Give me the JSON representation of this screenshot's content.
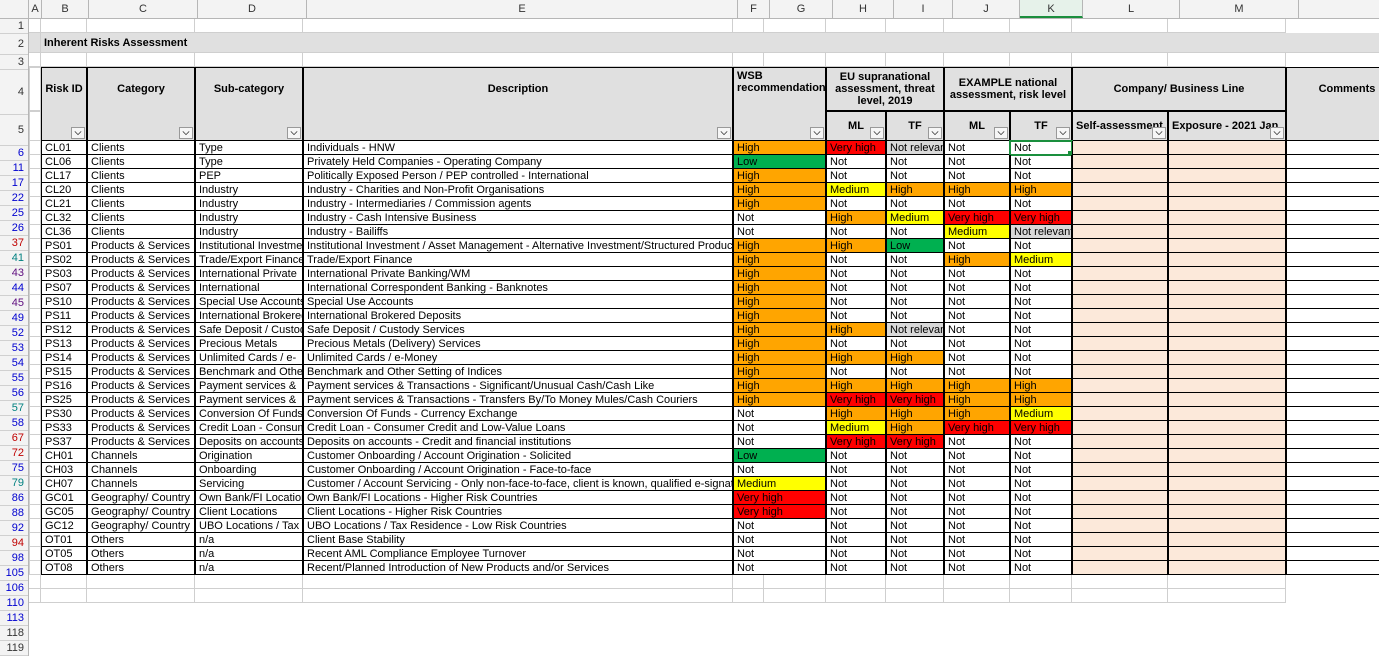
{
  "cols": [
    "A",
    "B",
    "C",
    "D",
    "E",
    "F",
    "G",
    "H",
    "I",
    "J",
    "K",
    "L",
    "M"
  ],
  "title": "Inherent Risks Assessment",
  "headers": {
    "riskId": "Risk ID",
    "category": "Category",
    "subcat": "Sub-category",
    "desc": "Description",
    "wsb": "WSB recommendation",
    "eu": "EU supranational assessment, threat level, 2019",
    "ex": "EXAMPLE national assessment, risk level",
    "company": "Company/ Business Line",
    "comments": "Comments",
    "ml": "ML",
    "tf": "TF",
    "selfA": "Self-assessment",
    "exposure": "Exposure - 2021 Jan"
  },
  "rowNums": [
    "1",
    "2",
    "3",
    "4",
    "5"
  ],
  "rows": [
    {
      "rn": "6",
      "id": "CL01",
      "cat": "Clients",
      "sub": "Type",
      "desc": "Individuals - HNW",
      "wsb": "High",
      "euML": "Very high",
      "euTF": "Not relevant",
      "exML": "Not",
      "exTF": "Not"
    },
    {
      "rn": "11",
      "id": "CL06",
      "cat": "Clients",
      "sub": "Type",
      "desc": "Privately Held Companies - Operating Company",
      "wsb": "Low",
      "euML": "Not",
      "euTF": "Not",
      "exML": "Not",
      "exTF": "Not"
    },
    {
      "rn": "17",
      "id": "CL17",
      "cat": "Clients",
      "sub": "PEP",
      "desc": "Politically Exposed Person / PEP controlled - International",
      "wsb": "High",
      "euML": "Not",
      "euTF": "Not",
      "exML": "Not",
      "exTF": "Not"
    },
    {
      "rn": "22",
      "id": "CL20",
      "cat": "Clients",
      "sub": "Industry",
      "desc": "Industry - Charities and Non-Profit Organisations",
      "wsb": "High",
      "euML": "Medium",
      "euTF": "High",
      "exML": "High",
      "exTF": "High"
    },
    {
      "rn": "25",
      "id": "CL21",
      "cat": "Clients",
      "sub": "Industry",
      "desc": "Industry - Intermediaries / Commission agents",
      "wsb": "High",
      "euML": "Not",
      "euTF": "Not",
      "exML": "Not",
      "exTF": "Not"
    },
    {
      "rn": "26",
      "id": "CL32",
      "cat": "Clients",
      "sub": "Industry",
      "desc": "Industry - Cash Intensive Business",
      "wsb": "Not",
      "euML": "High",
      "euTF": "Medium",
      "exML": "Very high",
      "exTF": "Very high"
    },
    {
      "rn": "37",
      "id": "CL36",
      "cat": "Clients",
      "sub": "Industry",
      "desc": "Industry - Bailiffs",
      "wsb": "Not",
      "euML": "Not",
      "euTF": "Not",
      "exML": "Medium",
      "exTF": "Not relevant"
    },
    {
      "rn": "41",
      "id": "PS01",
      "cat": "Products & Services",
      "sub": "Institutional Investment",
      "desc": "Institutional Investment / Asset Management - Alternative Investment/Structured Products",
      "wsb": "High",
      "euML": "High",
      "euTF": "Low",
      "exML": "Not",
      "exTF": "Not"
    },
    {
      "rn": "43",
      "id": "PS02",
      "cat": "Products & Services",
      "sub": "Trade/Export Finance",
      "desc": "Trade/Export Finance",
      "wsb": "High",
      "euML": "Not",
      "euTF": "Not",
      "exML": "High",
      "exTF": "Medium"
    },
    {
      "rn": "44",
      "id": "PS03",
      "cat": "Products & Services",
      "sub": "International Private",
      "desc": "International Private Banking/WM",
      "wsb": "High",
      "euML": "Not",
      "euTF": "Not",
      "exML": "Not",
      "exTF": "Not"
    },
    {
      "rn": "45",
      "id": "PS07",
      "cat": "Products & Services",
      "sub": "International",
      "desc": "International Correspondent Banking -  Banknotes",
      "wsb": "High",
      "euML": "Not",
      "euTF": "Not",
      "exML": "Not",
      "exTF": "Not"
    },
    {
      "rn": "49",
      "id": "PS10",
      "cat": "Products & Services",
      "sub": "Special Use Accounts",
      "desc": "Special Use Accounts",
      "wsb": "High",
      "euML": "Not",
      "euTF": "Not",
      "exML": "Not",
      "exTF": "Not"
    },
    {
      "rn": "52",
      "id": "PS11",
      "cat": "Products & Services",
      "sub": "International Brokered",
      "desc": "International Brokered Deposits",
      "wsb": "High",
      "euML": "Not",
      "euTF": "Not",
      "exML": "Not",
      "exTF": "Not"
    },
    {
      "rn": "53",
      "id": "PS12",
      "cat": "Products & Services",
      "sub": "Safe Deposit / Custody",
      "desc": "Safe Deposit / Custody Services",
      "wsb": "High",
      "euML": "High",
      "euTF": "Not relevant",
      "exML": "Not",
      "exTF": "Not"
    },
    {
      "rn": "54",
      "id": "PS13",
      "cat": "Products & Services",
      "sub": "Precious Metals",
      "desc": "Precious Metals (Delivery) Services",
      "wsb": "High",
      "euML": "Not",
      "euTF": "Not",
      "exML": "Not",
      "exTF": "Not"
    },
    {
      "rn": "55",
      "id": "PS14",
      "cat": "Products & Services",
      "sub": "Unlimited Cards / e-",
      "desc": "Unlimited Cards / e-Money",
      "wsb": "High",
      "euML": "High",
      "euTF": "High",
      "exML": "Not",
      "exTF": "Not"
    },
    {
      "rn": "56",
      "id": "PS15",
      "cat": "Products & Services",
      "sub": "Benchmark and Other",
      "desc": "Benchmark and Other Setting of Indices",
      "wsb": "High",
      "euML": "Not",
      "euTF": "Not",
      "exML": "Not",
      "exTF": "Not"
    },
    {
      "rn": "57",
      "id": "PS16",
      "cat": "Products & Services",
      "sub": "Payment services &",
      "desc": "Payment services & Transactions - Significant/Unusual Cash/Cash Like",
      "wsb": "High",
      "euML": "High",
      "euTF": "High",
      "exML": "High",
      "exTF": "High"
    },
    {
      "rn": "58",
      "id": "PS25",
      "cat": "Products & Services",
      "sub": "Payment services &",
      "desc": "Payment services & Transactions - Transfers By/To Money Mules/Cash Couriers",
      "wsb": "High",
      "euML": "Very high",
      "euTF": "Very high",
      "exML": "High",
      "exTF": "High"
    },
    {
      "rn": "67",
      "id": "PS30",
      "cat": "Products & Services",
      "sub": "Conversion Of Funds -",
      "desc": "Conversion Of Funds - Currency Exchange",
      "wsb": "Not",
      "euML": "High",
      "euTF": "High",
      "exML": "High",
      "exTF": "Medium"
    },
    {
      "rn": "72",
      "id": "PS33",
      "cat": "Products & Services",
      "sub": "Credit Loan - Consumer",
      "desc": "Credit Loan - Consumer Credit and Low-Value Loans",
      "wsb": "Not",
      "euML": "Medium",
      "euTF": "High",
      "exML": "Very high",
      "exTF": "Very high"
    },
    {
      "rn": "75",
      "id": "PS37",
      "cat": "Products & Services",
      "sub": "Deposits on accounts",
      "desc": "Deposits on accounts - Credit and financial institutions",
      "wsb": "Not",
      "euML": "Very high",
      "euTF": "Very high",
      "exML": "Not",
      "exTF": "Not"
    },
    {
      "rn": "79",
      "id": "CH01",
      "cat": "Channels",
      "sub": "Origination",
      "desc": "Customer Onboarding / Account Origination -  Solicited",
      "wsb": "Low",
      "euML": "Not",
      "euTF": "Not",
      "exML": "Not",
      "exTF": "Not"
    },
    {
      "rn": "86",
      "id": "CH03",
      "cat": "Channels",
      "sub": "Onboarding",
      "desc": "Customer Onboarding / Account Origination -  Face-to-face",
      "wsb": "Not",
      "euML": "Not",
      "euTF": "Not",
      "exML": "Not",
      "exTF": "Not"
    },
    {
      "rn": "88",
      "id": "CH07",
      "cat": "Channels",
      "sub": "Servicing",
      "desc": "Customer / Account Servicing - Only non-face-to-face, client is known, qualified e-signature (including",
      "wsb": "Medium",
      "euML": "Not",
      "euTF": "Not",
      "exML": "Not",
      "exTF": "Not"
    },
    {
      "rn": "92",
      "id": "GC01",
      "cat": "Geography/ Country",
      "sub": "Own Bank/FI Locations",
      "desc": "Own Bank/FI Locations -  Higher Risk Countries",
      "wsb": "Very high",
      "euML": "Not",
      "euTF": "Not",
      "exML": "Not",
      "exTF": "Not"
    },
    {
      "rn": "94",
      "id": "GC05",
      "cat": "Geography/ Country",
      "sub": "Client Locations",
      "desc": "Client Locations - Higher Risk Countries",
      "wsb": "Very high",
      "euML": "Not",
      "euTF": "Not",
      "exML": "Not",
      "exTF": "Not"
    },
    {
      "rn": "98",
      "id": "GC12",
      "cat": "Geography/ Country",
      "sub": "UBO Locations / Tax",
      "desc": "UBO Locations / Tax Residence - Low Risk Countries",
      "wsb": "Not",
      "euML": "Not",
      "euTF": "Not",
      "exML": "Not",
      "exTF": "Not"
    },
    {
      "rn": "105",
      "id": "OT01",
      "cat": "Others",
      "sub": "n/a",
      "desc": "Client Base Stability",
      "wsb": "Not",
      "euML": "Not",
      "euTF": "Not",
      "exML": "Not",
      "exTF": "Not"
    },
    {
      "rn": "106",
      "id": "OT05",
      "cat": "Others",
      "sub": "n/a",
      "desc": "Recent AML Compliance Employee Turnover",
      "wsb": "Not",
      "euML": "Not",
      "euTF": "Not",
      "exML": "Not",
      "exTF": "Not"
    },
    {
      "rn": "110",
      "id": "OT08",
      "cat": "Others",
      "sub": "n/a",
      "desc": "Recent/Planned Introduction of New Products and/or Services",
      "wsb": "Not",
      "euML": "Not",
      "euTF": "Not",
      "exML": "Not",
      "exTF": "Not"
    }
  ],
  "tailRows": [
    "113",
    "118",
    "119"
  ]
}
